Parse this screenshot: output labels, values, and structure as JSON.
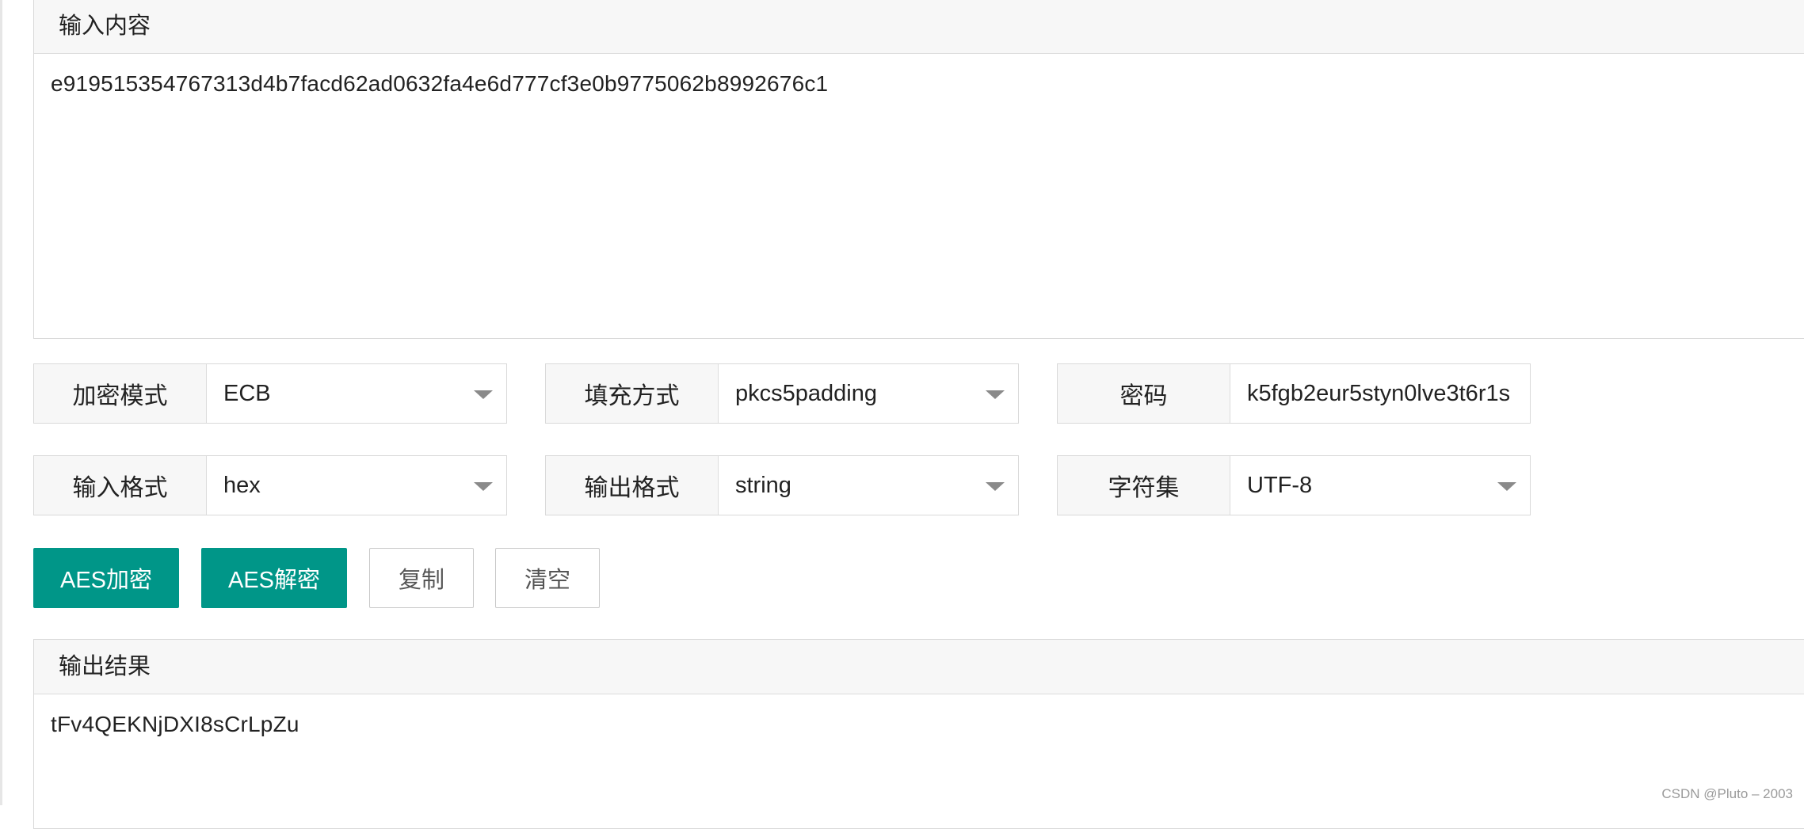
{
  "input": {
    "header": "输入内容",
    "value": "e919515354767313d4b7facd62ad0632fa4e6d777cf3e0b9775062b8992676c1"
  },
  "options": {
    "mode": {
      "label": "加密模式",
      "value": "ECB"
    },
    "padding": {
      "label": "填充方式",
      "value": "pkcs5padding"
    },
    "password": {
      "label": "密码",
      "value": "k5fgb2eur5styn0lve3t6r1s"
    },
    "input_format": {
      "label": "输入格式",
      "value": "hex"
    },
    "output_format": {
      "label": "输出格式",
      "value": "string"
    },
    "charset": {
      "label": "字符集",
      "value": "UTF-8"
    }
  },
  "buttons": {
    "encrypt": "AES加密",
    "decrypt": "AES解密",
    "copy": "复制",
    "clear": "清空"
  },
  "output": {
    "header": "输出结果",
    "value": "tFv4QEKNjDXI8sCrLpZu"
  },
  "watermark": "CSDN @Pluto – 2003",
  "colors": {
    "primary": "#009688",
    "border": "#d9d9d9",
    "label_bg": "#f7f7f7"
  }
}
